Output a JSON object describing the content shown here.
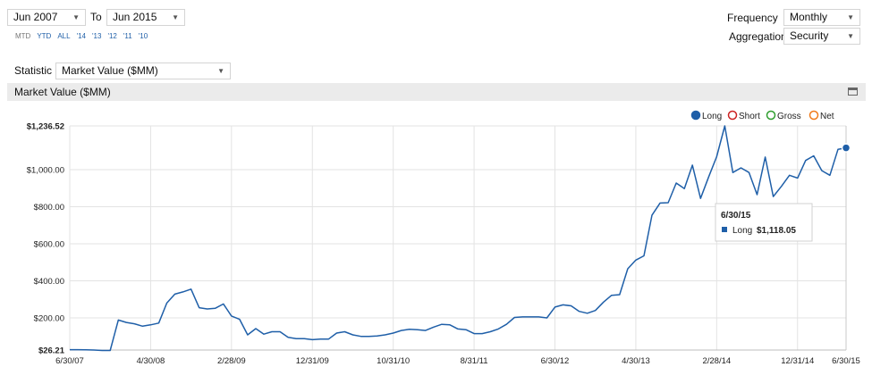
{
  "controls": {
    "start_date": "Jun 2007",
    "to_label": "To",
    "end_date": "Jun 2015",
    "frequency_label": "Frequency",
    "frequency_value": "Monthly",
    "aggregation_label": "Aggregation",
    "aggregation_value": "Security",
    "statistic_label": "Statistic",
    "statistic_value": "Market Value ($MM)",
    "quick_ranges": [
      "MTD",
      "YTD",
      "ALL",
      "'14",
      "'13",
      "'12",
      "'11",
      "'10"
    ]
  },
  "panel": {
    "title": "Market Value ($MM)"
  },
  "colors": {
    "long": "#1f5fa8",
    "short": "#cc2222",
    "gross": "#2e9e2e",
    "net": "#f07a1a",
    "grid": "#e3e3e3"
  },
  "chart_data": {
    "type": "line",
    "title": "",
    "y_ticks": [
      26.21,
      200,
      400,
      600,
      800,
      1000,
      1236.52
    ],
    "y_tick_labels": [
      "$26.21",
      "$200.00",
      "$400.00",
      "$600.00",
      "$800.00",
      "$1,000.00",
      "$1,236.52"
    ],
    "ylim": [
      26.21,
      1236.52
    ],
    "x_tick_labels": [
      "6/30/07",
      "4/30/08",
      "2/28/09",
      "12/31/09",
      "10/31/10",
      "8/31/11",
      "6/30/12",
      "4/30/13",
      "2/28/14",
      "12/31/14",
      "6/30/15"
    ],
    "x_tick_months": [
      0,
      10,
      20,
      30,
      40,
      50,
      60,
      70,
      80,
      90,
      96
    ],
    "legend": {
      "position": "top-right",
      "entries": [
        "Long",
        "Short",
        "Gross",
        "Net"
      ]
    },
    "grid": true,
    "series": [
      {
        "name": "Long",
        "values": [
          28,
          28,
          27,
          26,
          24,
          24,
          188,
          175,
          168,
          155,
          162,
          172,
          280,
          328,
          340,
          355,
          255,
          248,
          252,
          275,
          210,
          192,
          108,
          142,
          112,
          125,
          125,
          95,
          88,
          88,
          82,
          85,
          85,
          118,
          125,
          108,
          100,
          100,
          102,
          108,
          118,
          132,
          138,
          136,
          132,
          150,
          165,
          162,
          140,
          136,
          115,
          115,
          125,
          140,
          165,
          202,
          205,
          205,
          205,
          200,
          258,
          270,
          265,
          235,
          225,
          240,
          285,
          322,
          325,
          465,
          512,
          535,
          755,
          820,
          822,
          928,
          898,
          1025,
          845,
          960,
          1070,
          1236.52,
          985,
          1010,
          985,
          865,
          1068,
          855,
          910,
          970,
          955,
          1050,
          1075,
          995,
          970,
          1110,
          1118.05
        ]
      }
    ],
    "tooltip": {
      "date": "6/30/15",
      "series": "Long",
      "value": "$1,118.05"
    }
  }
}
